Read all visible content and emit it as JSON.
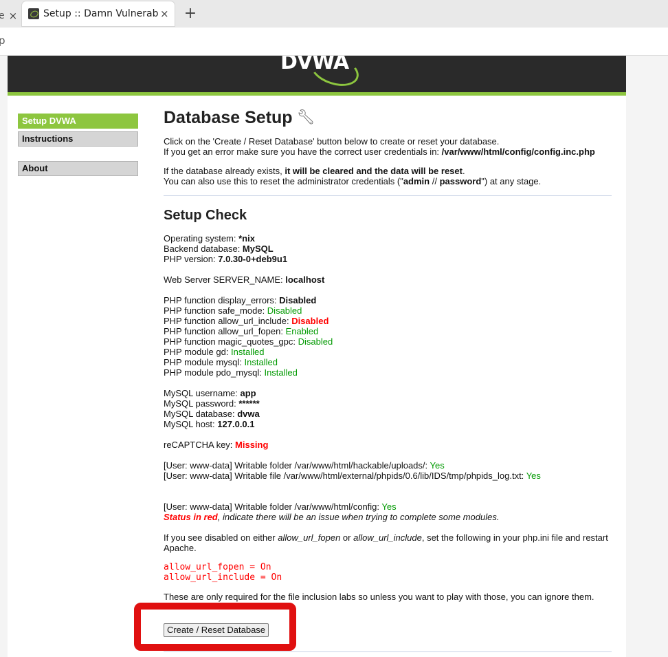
{
  "browser": {
    "prev_tab_fragment": "e",
    "prev_tab_close": "×",
    "active_tab_title": "Setup :: Damn Vulnerable",
    "active_tab_close": "×",
    "new_tab": "+",
    "address_fragment": "p"
  },
  "header": {
    "logo_text": "DVWA"
  },
  "sidebar": {
    "items": [
      {
        "label": "Setup DVWA",
        "selected": true
      },
      {
        "label": "Instructions",
        "selected": false
      },
      {
        "label": "About",
        "selected": false
      }
    ]
  },
  "main": {
    "title": "Database Setup",
    "intro": {
      "line1": "Click on the 'Create / Reset Database' button below to create or reset your database.",
      "line2_pre": "If you get an error make sure you have the correct user credentials in: ",
      "line2_path": "/var/www/html/config/config.inc.php",
      "line3_pre": "If the database already exists, ",
      "line3_bold": "it will be cleared and the data will be reset",
      "line3_post": ".",
      "line4_pre": "You can also use this to reset the administrator credentials (\"",
      "line4_user": "admin",
      "line4_sep": " // ",
      "line4_pass": "password",
      "line4_post": "\") at any stage."
    },
    "setup_check_title": "Setup Check",
    "system": {
      "os_label": "Operating system: ",
      "os_value": "*nix",
      "db_label": "Backend database: ",
      "db_value": "MySQL",
      "php_label": "PHP version: ",
      "php_value": "7.0.30-0+deb9u1",
      "server_label": "Web Server SERVER_NAME: ",
      "server_value": "localhost"
    },
    "php_checks": [
      {
        "label": "PHP function display_errors: ",
        "value": "Disabled",
        "status": "bold"
      },
      {
        "label": "PHP function safe_mode: ",
        "value": "Disabled",
        "status": "green"
      },
      {
        "label": "PHP function allow_url_include: ",
        "value": "Disabled",
        "status": "red"
      },
      {
        "label": "PHP function allow_url_fopen: ",
        "value": "Enabled",
        "status": "green"
      },
      {
        "label": "PHP function magic_quotes_gpc: ",
        "value": "Disabled",
        "status": "green"
      },
      {
        "label": "PHP module gd: ",
        "value": "Installed",
        "status": "green"
      },
      {
        "label": "PHP module mysql: ",
        "value": "Installed",
        "status": "green"
      },
      {
        "label": "PHP module pdo_mysql: ",
        "value": "Installed",
        "status": "green"
      }
    ],
    "mysql": {
      "user_label": "MySQL username: ",
      "user_value": "app",
      "pass_label": "MySQL password: ",
      "pass_value": "******",
      "db_label": "MySQL database: ",
      "db_value": "dvwa",
      "host_label": "MySQL host: ",
      "host_value": "127.0.0.1"
    },
    "recaptcha_label": "reCAPTCHA key: ",
    "recaptcha_value": "Missing",
    "writable": {
      "uploads_label": "[User: www-data] Writable folder /var/www/html/hackable/uploads/: ",
      "uploads_value": "Yes",
      "phpids_label": "[User: www-data] Writable file /var/www/html/external/phpids/0.6/lib/IDS/tmp/phpids_log.txt: ",
      "phpids_value": "Yes",
      "config_label": "[User: www-data] Writable folder /var/www/html/config: ",
      "config_value": "Yes"
    },
    "status_note_red": "Status in red",
    "status_note_rest": ", indicate there will be an issue when trying to complete some modules.",
    "disabled_note": {
      "pre": "If you see disabled on either ",
      "opt1": "allow_url_fopen",
      "mid": " or ",
      "opt2": "allow_url_include",
      "post": ", set the following in your php.ini file and restart",
      "line2": "Apache."
    },
    "ini_lines": [
      "allow_url_fopen = On",
      "allow_url_include = On"
    ],
    "inclusion_note": "These are only required for the file inclusion labs so unless you want to play with those, you can ignore them.",
    "create_button": "Create / Reset Database"
  },
  "colors": {
    "accent_green": "#8dc63f",
    "status_green": "#009900",
    "status_red": "#ff0000",
    "annotation_red": "#e01010"
  }
}
